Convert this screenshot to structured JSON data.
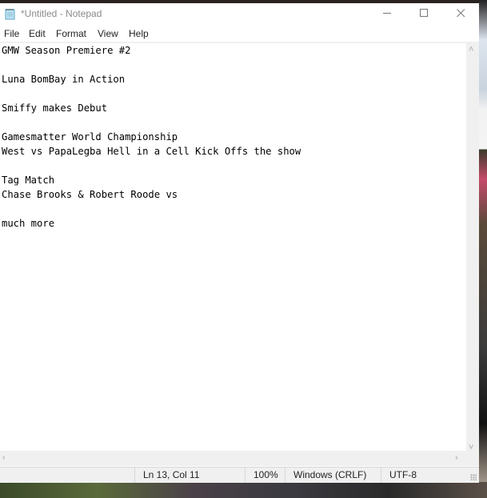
{
  "window": {
    "title": "*Untitled - Notepad",
    "app_icon": "notepad-icon",
    "controls": {
      "minimize": "minimize-icon",
      "maximize": "maximize-icon",
      "close": "close-icon"
    }
  },
  "menu": {
    "items": [
      {
        "label": "File"
      },
      {
        "label": "Edit"
      },
      {
        "label": "Format"
      },
      {
        "label": "View"
      },
      {
        "label": "Help"
      }
    ]
  },
  "editor": {
    "content": "GMW Season Premiere #2\n\nLuna BomBay in Action\n\nSmiffy makes Debut\n\nGamesmatter World Championship\nWest vs PapaLegba Hell in a Cell Kick Offs the show\n\nTag Match\nChase Brooks & Robert Roode vs\n\nmuch more"
  },
  "status_bar": {
    "position": "Ln 13, Col 11",
    "zoom": "100%",
    "line_ending": "Windows (CRLF)",
    "encoding": "UTF-8"
  }
}
